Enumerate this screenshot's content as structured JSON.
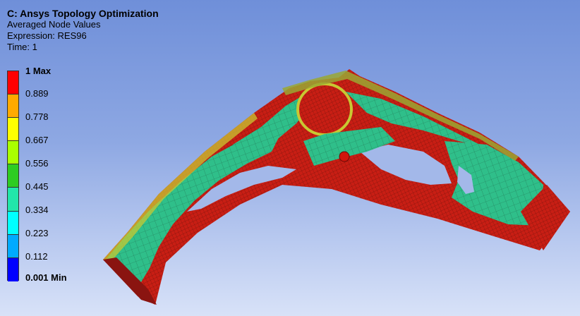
{
  "header": {
    "title": "C: Ansys Topology Optimization",
    "line1": "Averaged Node Values",
    "line2": "Expression: RES96",
    "line3": "Time: 1"
  },
  "legend": {
    "max_label": "1 Max",
    "min_label": "0.001 Min",
    "labels": [
      "1 Max",
      "0.889",
      "0.778",
      "0.667",
      "0.556",
      "0.445",
      "0.334",
      "0.223",
      "0.112",
      "0.001 Min"
    ],
    "colors": [
      "#ff0000",
      "#ffaa00",
      "#ffff00",
      "#aaff00",
      "#2ecc22",
      "#22e6aa",
      "#00ffff",
      "#00aaff",
      "#0000ff"
    ]
  },
  "model": {
    "colors": {
      "red": "#c81e14",
      "green": "#2fbf8a",
      "yellow": "#c8c832",
      "olive": "#9aa832",
      "dark_red": "#8a1410"
    }
  }
}
